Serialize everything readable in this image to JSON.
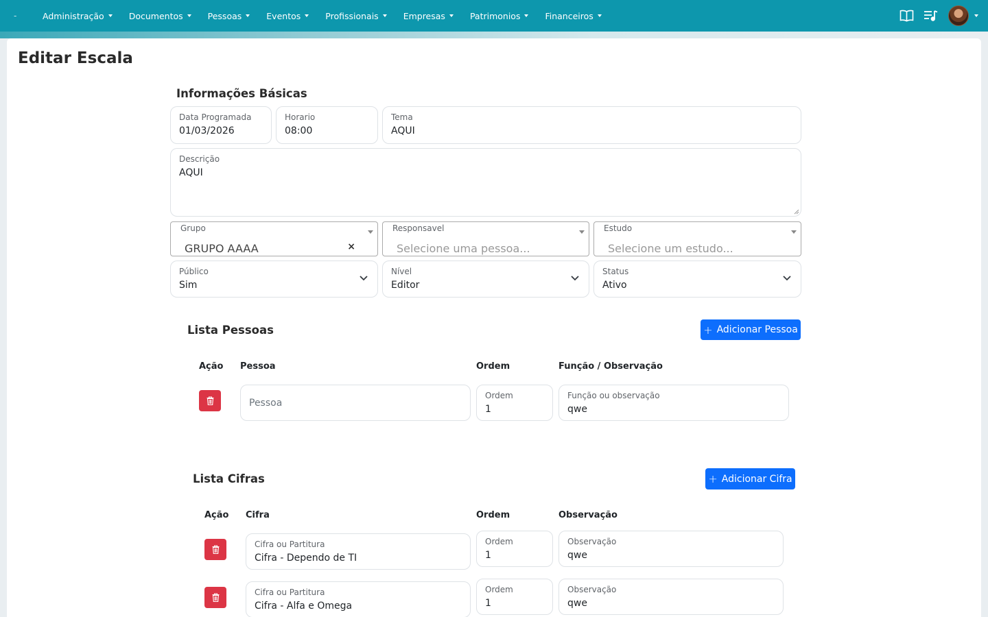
{
  "nav": {
    "brand": "-",
    "items": [
      {
        "label": "Administração"
      },
      {
        "label": "Documentos"
      },
      {
        "label": "Pessoas"
      },
      {
        "label": "Eventos"
      },
      {
        "label": "Profissionais"
      },
      {
        "label": "Empresas"
      },
      {
        "label": "Patrimonios"
      },
      {
        "label": "Financeiros"
      }
    ],
    "icons": [
      "book-icon",
      "playlist-music-icon"
    ],
    "colors": {
      "bg": "#0d97ad",
      "text": "#ffffff"
    }
  },
  "page": {
    "title": "Editar Escala"
  },
  "basic_info": {
    "title": "Informações Básicas",
    "data_programada": {
      "label": "Data Programada",
      "value": "01/03/2026"
    },
    "horario": {
      "label": "Horario",
      "value": "08:00"
    },
    "tema": {
      "label": "Tema",
      "value": "AQUI"
    },
    "descricao": {
      "label": "Descrição",
      "value": "AQUI"
    },
    "grupo": {
      "label": "Grupo",
      "value": "GRUPO AAAA",
      "clear": "×"
    },
    "responsavel": {
      "label": "Responsavel",
      "placeholder": "Selecione uma pessoa..."
    },
    "estudo": {
      "label": "Estudo",
      "placeholder": "Selecione um estudo..."
    },
    "publico": {
      "label": "Público",
      "value": "Sim"
    },
    "nivel": {
      "label": "Nível",
      "value": "Editor"
    },
    "status": {
      "label": "Status",
      "value": "Ativo"
    }
  },
  "pessoas": {
    "title": "Lista Pessoas",
    "add_label": "Adicionar Pessoa",
    "headers": {
      "acao": "Ação",
      "pessoa": "Pessoa",
      "ordem": "Ordem",
      "funcao": "Função / Observação"
    },
    "rows": [
      {
        "pessoa_placeholder": "Pessoa",
        "ordem_label": "Ordem",
        "ordem": "1",
        "funcao_label": "Função ou observação",
        "funcao": "qwe"
      }
    ]
  },
  "cifras": {
    "title": "Lista Cifras",
    "add_label": "Adicionar Cifra",
    "headers": {
      "acao": "Ação",
      "cifra": "Cifra",
      "ordem": "Ordem",
      "observacao": "Observação"
    },
    "rows": [
      {
        "cifra_label": "Cifra ou Partitura",
        "cifra": "Cifra - Dependo de TI",
        "ordem_label": "Ordem",
        "ordem": "1",
        "obs_label": "Observação",
        "obs": "qwe"
      },
      {
        "cifra_label": "Cifra ou Partitura",
        "cifra": "Cifra - Alfa e Omega",
        "ordem_label": "Ordem",
        "ordem": "1",
        "obs_label": "Observação",
        "obs": "qwe"
      }
    ]
  },
  "colors": {
    "primary": "#0d6efd",
    "danger": "#dc3545"
  }
}
